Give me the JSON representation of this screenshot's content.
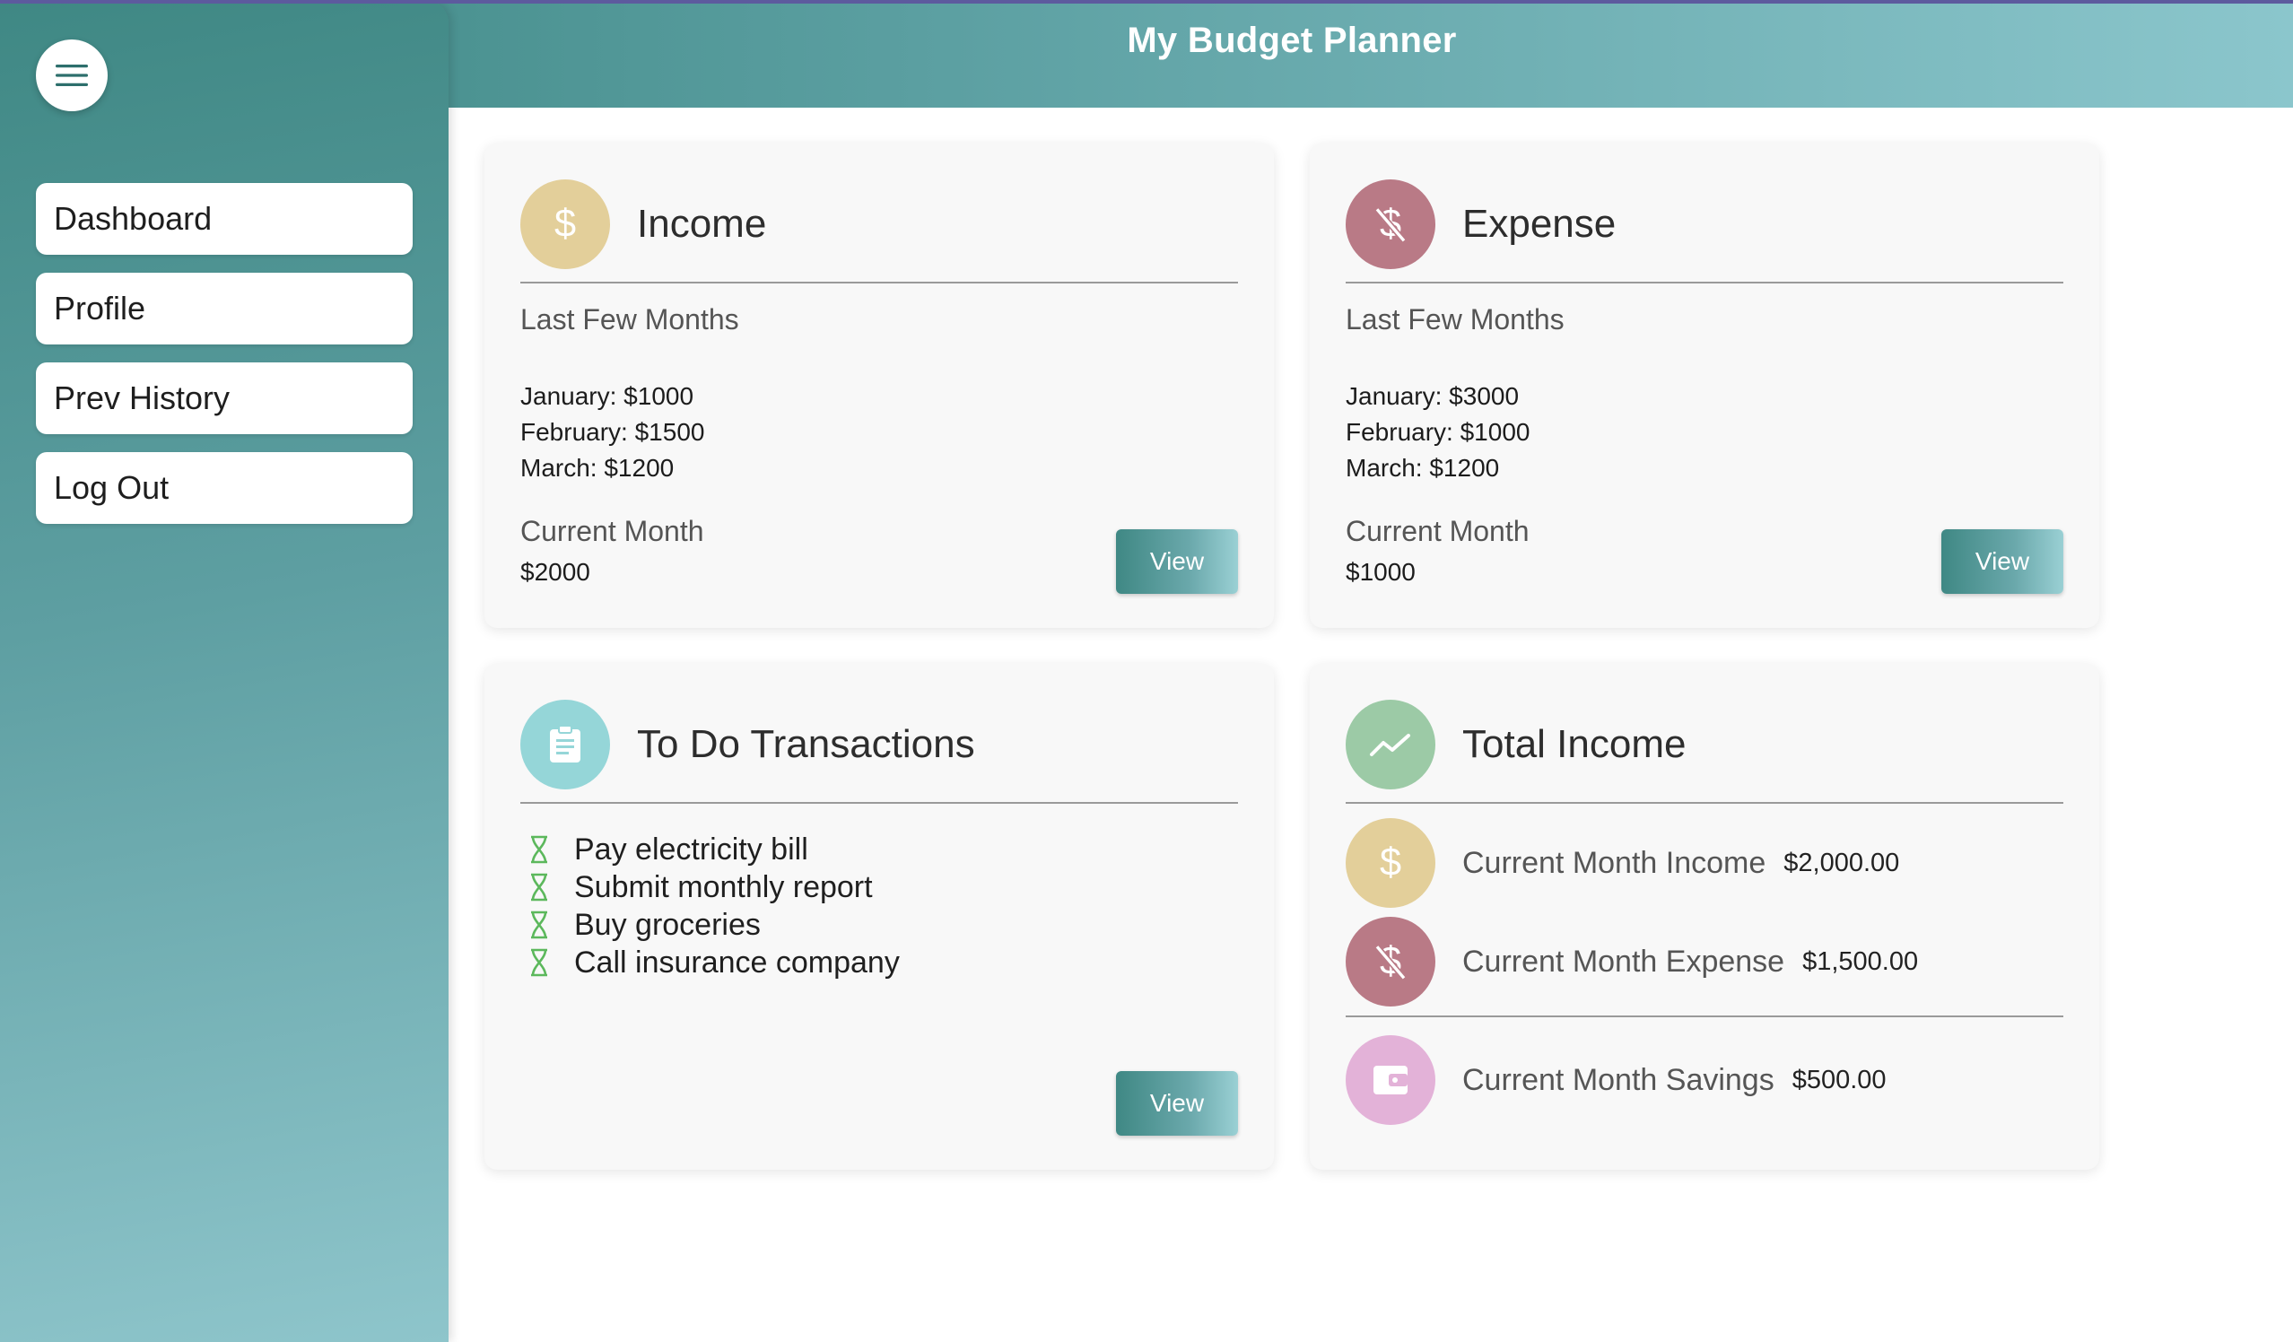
{
  "header": {
    "title": "My Budget Planner"
  },
  "sidebar": {
    "menu_icon": "hamburger-menu-icon",
    "items": [
      {
        "label": "Dashboard"
      },
      {
        "label": "Profile"
      },
      {
        "label": "Prev History"
      },
      {
        "label": "Log Out"
      }
    ]
  },
  "income": {
    "title": "Income",
    "icon": "dollar-icon",
    "icon_color": "#e3cf9a",
    "section_label": "Last Few Months",
    "months": [
      "January: $1000",
      "February: $1500",
      "March: $1200"
    ],
    "current_label": "Current Month",
    "current_value": "$2000",
    "button": "View"
  },
  "expense": {
    "title": "Expense",
    "icon": "no-dollar-icon",
    "icon_color": "#b97a86",
    "section_label": "Last Few Months",
    "months": [
      "January: $3000",
      "February: $1000",
      "March: $1200"
    ],
    "current_label": "Current Month",
    "current_value": "$1000",
    "button": "View"
  },
  "todo": {
    "title": "To Do Transactions",
    "icon": "clipboard-icon",
    "icon_color": "#95d6d8",
    "item_icon": "hourglass-icon",
    "items": [
      "Pay electricity bill",
      "Submit monthly report",
      "Buy groceries",
      "Call insurance company"
    ],
    "button": "View"
  },
  "total": {
    "title": "Total Income",
    "icon": "trending-up-icon",
    "icon_color": "#9ccaa6",
    "rows": [
      {
        "label": "Current Month Income",
        "amount": "$2,000.00",
        "icon": "dollar-icon",
        "color": "#e3cf9a"
      },
      {
        "label": "Current Month Expense",
        "amount": "$1,500.00",
        "icon": "no-dollar-icon",
        "color": "#b97a86"
      },
      {
        "label": "Current Month Savings",
        "amount": "$500.00",
        "icon": "wallet-icon",
        "color": "#e3b2d8"
      }
    ]
  },
  "colors": {
    "accent": "#3f8884",
    "accent_light": "#8ec5cb",
    "todo_icon": "#5cb85c"
  }
}
